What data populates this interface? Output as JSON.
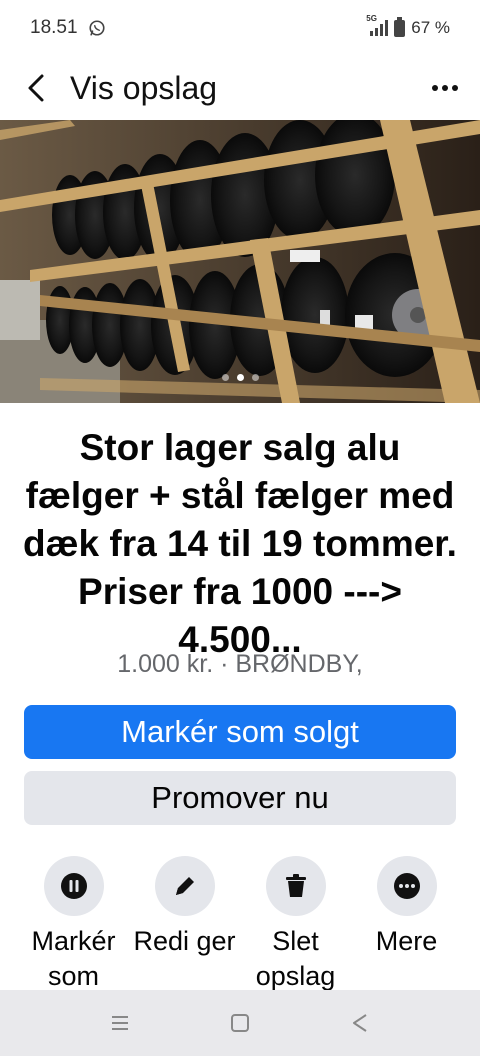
{
  "status_bar": {
    "time": "18.51",
    "network": "5G",
    "battery": "67 %"
  },
  "header": {
    "title": "Vis opslag"
  },
  "gallery": {
    "image_count": 3,
    "active_index": 1
  },
  "listing": {
    "title": "Stor lager salg alu fælger + stål fælger med dæk fra 14 til 19 tommer. Priser fra 1000 ---> 4.500...",
    "meta": "1.000 kr. · BRØNDBY,"
  },
  "buttons": {
    "mark_sold": "Markér som solgt",
    "promote": "Promover nu"
  },
  "actions": [
    {
      "label": "Markér som",
      "icon": "pause-icon"
    },
    {
      "label": "Redi ger",
      "icon": "pencil-icon"
    },
    {
      "label": "Slet opslag",
      "icon": "trash-icon"
    },
    {
      "label": "Mere",
      "icon": "more-horizontal-icon"
    }
  ],
  "colors": {
    "primary": "#1877f2",
    "secondary_bg": "#e4e6eb",
    "muted_text": "#65676b"
  }
}
